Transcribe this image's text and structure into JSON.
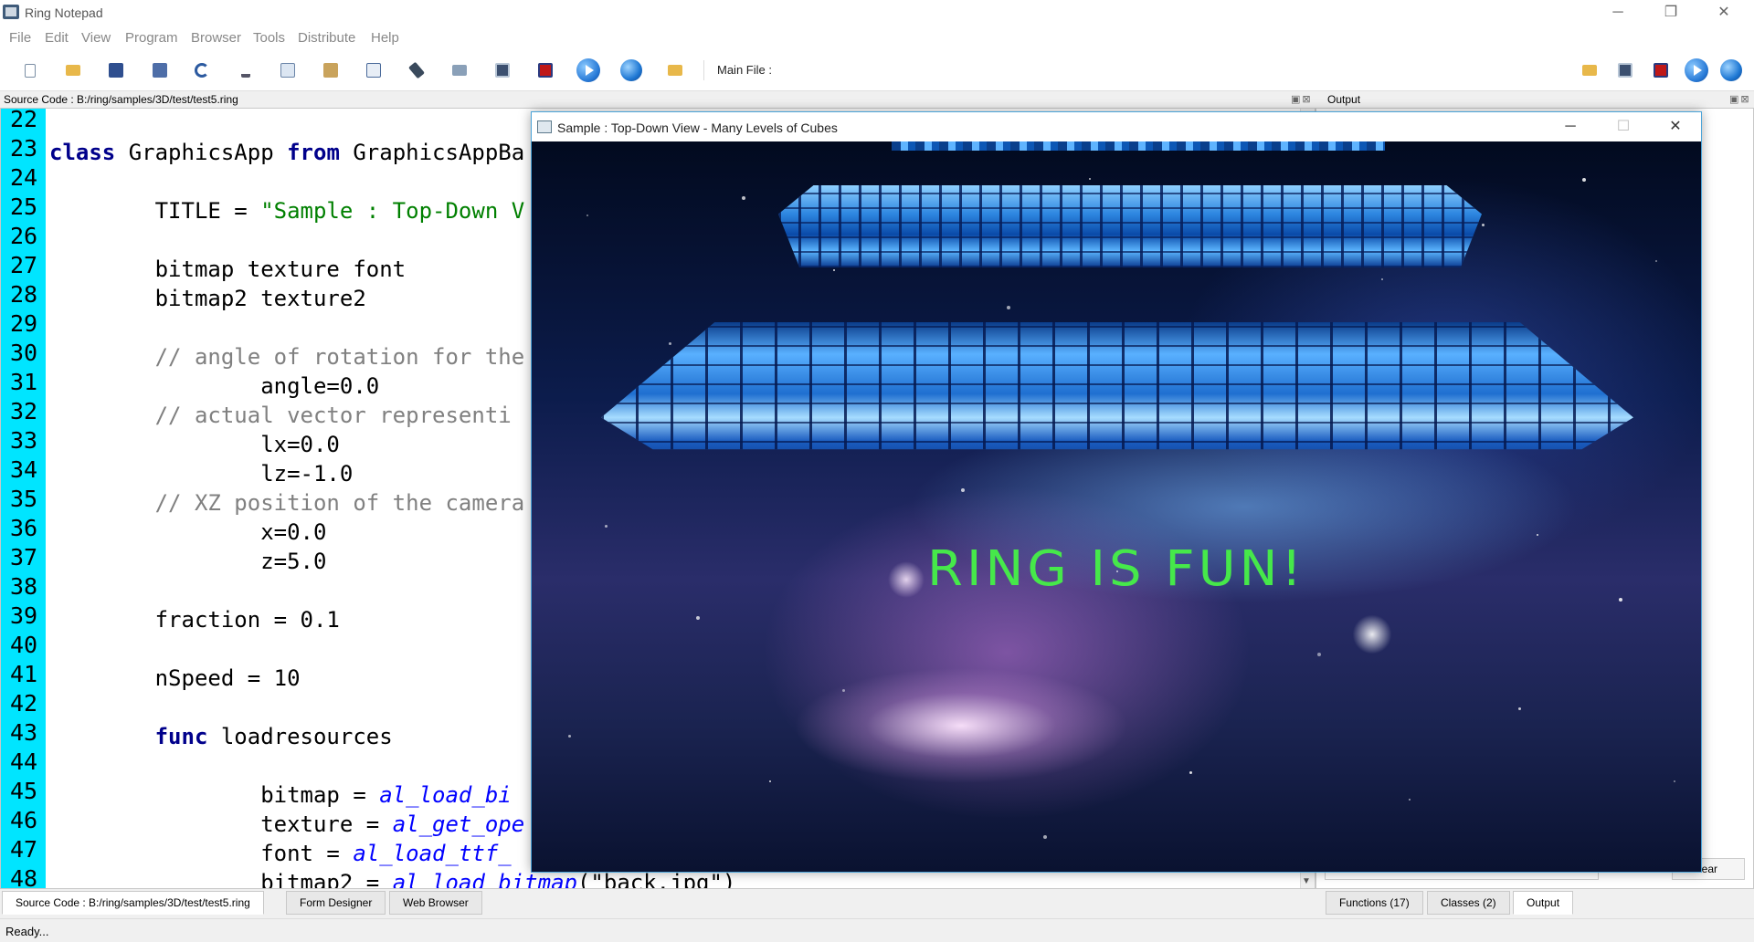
{
  "window": {
    "title": "Ring Notepad",
    "controls": {
      "minimize": "─",
      "restore": "❐",
      "close": "✕"
    }
  },
  "menu": [
    "File",
    "Edit",
    "View",
    "Program",
    "Browser",
    "Tools",
    "Distribute",
    "Help"
  ],
  "toolbar": {
    "main_file_label": "Main File :"
  },
  "source_panel": {
    "header": "Source Code : B:/ring/samples/3D/test/test5.ring"
  },
  "output_panel": {
    "header": "Output",
    "clear_label": "lear"
  },
  "editor": {
    "lines": [
      {
        "n": "22"
      },
      {
        "n": "23"
      },
      {
        "n": "24"
      },
      {
        "n": "25"
      },
      {
        "n": "26"
      },
      {
        "n": "27"
      },
      {
        "n": "28"
      },
      {
        "n": "29"
      },
      {
        "n": "30"
      },
      {
        "n": "31"
      },
      {
        "n": "32"
      },
      {
        "n": "33"
      },
      {
        "n": "34"
      },
      {
        "n": "35"
      },
      {
        "n": "36"
      },
      {
        "n": "37"
      },
      {
        "n": "38"
      },
      {
        "n": "39"
      },
      {
        "n": "40"
      },
      {
        "n": "41"
      },
      {
        "n": "42"
      },
      {
        "n": "43"
      },
      {
        "n": "44"
      },
      {
        "n": "45"
      },
      {
        "n": "46"
      },
      {
        "n": "47"
      },
      {
        "n": "48"
      }
    ],
    "code": {
      "l23_kw1": "class",
      "l23_mid": " GraphicsApp ",
      "l23_kw2": "from",
      "l23_end": " GraphicsAppBa",
      "l25_pre": "        TITLE = ",
      "l25_str": "\"Sample : Top-Down V",
      "l27": "        bitmap texture font",
      "l28": "        bitmap2 texture2",
      "l30": "        // angle of rotation for the",
      "l31": "                angle=0.0",
      "l32": "        // actual vector representi",
      "l33": "                lx=0.0",
      "l34": "                lz=-1.0",
      "l35": "        // XZ position of the camera",
      "l36": "                x=0.0",
      "l37": "                z=5.0",
      "l39": "        fraction = 0.1",
      "l41": "        nSpeed = 10",
      "l43_pre": "        ",
      "l43_kw": "func",
      "l43_end": " loadresources",
      "l45_pre": "                bitmap = ",
      "l45_fn": "al_load_bi",
      "l46_pre": "                texture = ",
      "l46_fn": "al_get_ope",
      "l47_pre": "                font = ",
      "l47_fn": "al_load_ttf_",
      "l48_pre": "                bitmap2 = ",
      "l48_fn": "al_load_bitmap",
      "l48_end": "(\"back.jpg\")"
    }
  },
  "bottom_tabs_left": [
    "Source Code : B:/ring/samples/3D/test/test5.ring",
    "Form Designer",
    "Web Browser"
  ],
  "bottom_tabs_right": [
    "Functions (17)",
    "Classes (2)",
    "Output"
  ],
  "status": "Ready...",
  "graphics_window": {
    "title": "Sample : Top-Down View - Many Levels of Cubes",
    "text": "RING IS FUN!",
    "controls": {
      "minimize": "─",
      "maximize": "☐",
      "close": "✕"
    }
  },
  "colors": {
    "gutter": "#00e5ff",
    "keyword": "#00008b",
    "string": "#008000",
    "comment": "#808080",
    "function_call": "#0000ff",
    "fun_text": "#46e84a"
  }
}
